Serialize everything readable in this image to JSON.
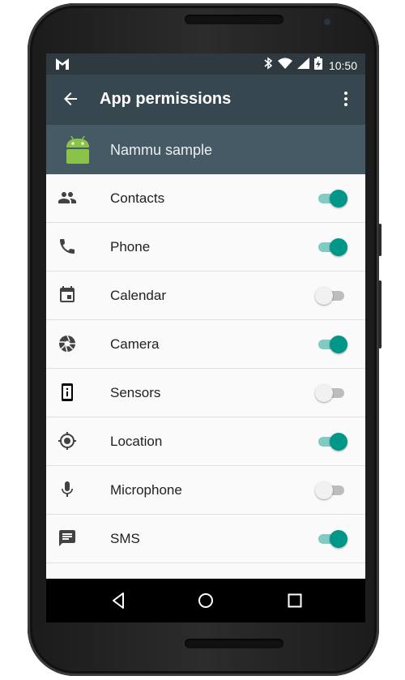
{
  "status_bar": {
    "time": "10:50",
    "icons": [
      "gmail-icon",
      "bluetooth-icon",
      "wifi-icon",
      "cellular-signal-icon",
      "battery-charging-icon"
    ]
  },
  "app_bar": {
    "title": "App permissions",
    "back_icon": "arrow-back-icon",
    "menu_icon": "more-vert-icon"
  },
  "app_header": {
    "name": "Nammu sample",
    "icon": "android-icon"
  },
  "permissions": [
    {
      "label": "Contacts",
      "icon": "contacts-icon",
      "enabled": true
    },
    {
      "label": "Phone",
      "icon": "phone-icon",
      "enabled": true
    },
    {
      "label": "Calendar",
      "icon": "calendar-icon",
      "enabled": false
    },
    {
      "label": "Camera",
      "icon": "camera-icon",
      "enabled": true
    },
    {
      "label": "Sensors",
      "icon": "sensors-icon",
      "enabled": false
    },
    {
      "label": "Location",
      "icon": "location-icon",
      "enabled": true
    },
    {
      "label": "Microphone",
      "icon": "microphone-icon",
      "enabled": false
    },
    {
      "label": "SMS",
      "icon": "sms-icon",
      "enabled": true
    }
  ],
  "nav_bar": [
    "back-nav-icon",
    "home-nav-icon",
    "recents-nav-icon"
  ],
  "colors": {
    "status_bar": "#2f3a40",
    "app_bar": "#37474f",
    "app_header": "#455a64",
    "switch_on_thumb": "#009688",
    "switch_on_track": "#80cbc4",
    "switch_off_thumb": "#f1f1f1",
    "switch_off_track": "#bdbdbd",
    "android_green": "#8bc34a"
  }
}
